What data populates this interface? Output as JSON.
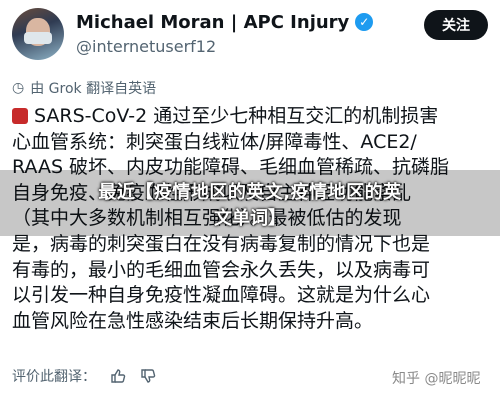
{
  "post": {
    "author_name": "Michael Moran | APC Injury",
    "handle": "@internetuserf12",
    "follow_label": "关注",
    "translation_note": "由 Grok 翻译自英语",
    "body_lines": [
      "SARS-CoV-2 通过至少七种相互交汇的机制损害",
      "心血管系统：刺突蛋白线粒体/屏障毒性、ACE2/",
      "RAAS 破坏、内皮功能障碍、毛细血管稀疏、抗磷脂",
      "自身免疫、免疫血栓形成以及自主神经功能紊乱",
      "（其中大多数机制相互强化）。最被低估的发现",
      "是，病毒的刺突蛋白在没有病毒复制的情况下也是",
      "有毒的，最小的毛细血管会永久丢失，以及病毒可",
      "以引发一种自身免疫性凝血障碍。这就是为什么心",
      "血管风险在急性感染结束后长期保持升高。"
    ]
  },
  "overlay": {
    "line1": "最近【疫情地区的英文,疫情地区的英",
    "line2": "文单词】"
  },
  "footer": {
    "rate_label": "评价此翻译："
  },
  "watermark": "知乎 @昵昵昵",
  "icons": {
    "verified": "verified-check-icon",
    "history": "history-icon",
    "heart": "anatomical-heart-icon",
    "thumbs_up": "thumbs-up-icon",
    "thumbs_down": "thumbs-down-icon"
  }
}
